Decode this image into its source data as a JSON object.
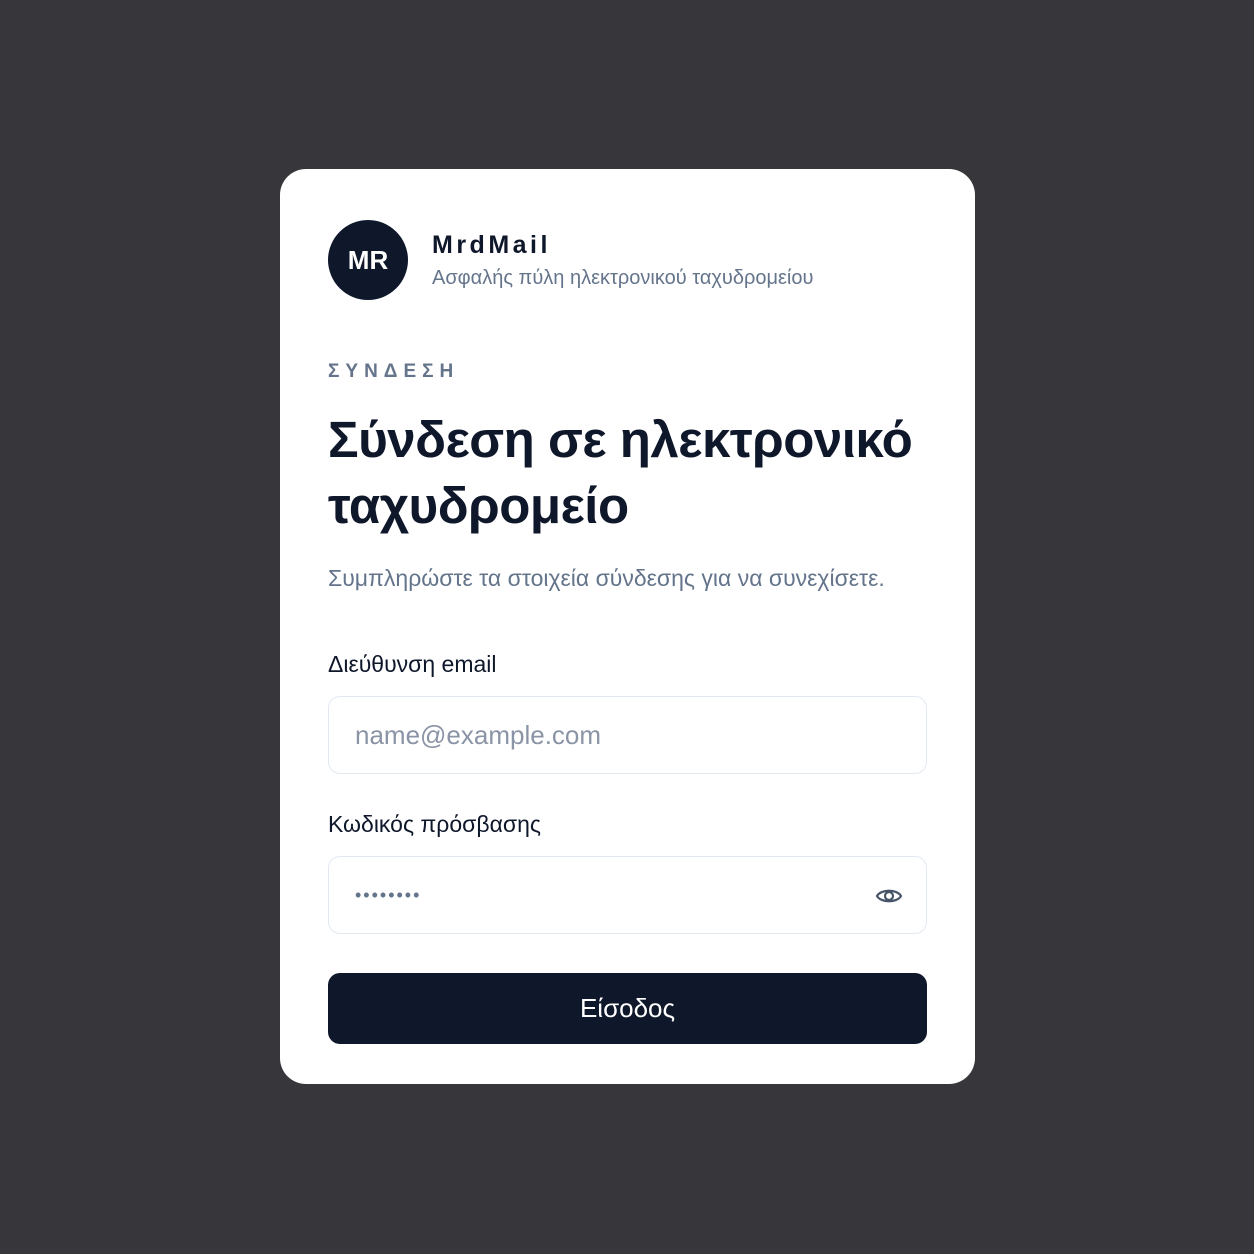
{
  "brand": {
    "initials": "MR",
    "name": "MrdMail",
    "tagline": "Ασφαλής πύλη ηλεκτρονικού ταχυδρομείου"
  },
  "login": {
    "eyebrow": "ΣΥΝΔΕΣΗ",
    "title": "Σύνδεση σε ηλεκτρονικό ταχυδρομείο",
    "subtitle": "Συμπληρώστε τα στοιχεία σύνδεσης για να συνεχίσετε.",
    "email": {
      "label": "Διεύθυνση email",
      "placeholder": "name@example.com",
      "value": ""
    },
    "password": {
      "label": "Κωδικός πρόσβασης",
      "value": "••••••••",
      "toggle_icon": "eye-icon"
    },
    "submit_label": "Είσοδος"
  },
  "colors": {
    "background": "#37373b",
    "card": "#ffffff",
    "primary": "#0f172a",
    "muted": "#64748b",
    "border": "#e2e8f0"
  }
}
